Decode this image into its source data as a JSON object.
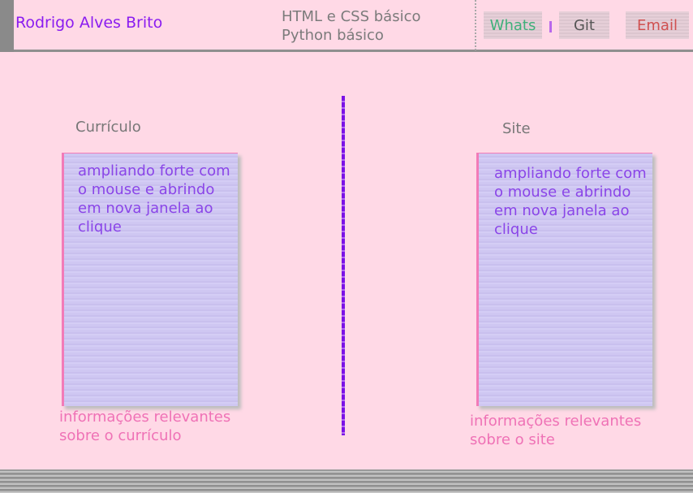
{
  "header": {
    "name": "Rodrigo Alves Brito",
    "skills": [
      "HTML e CSS básico",
      "Python básico"
    ],
    "contacts": {
      "whats": "Whats",
      "git": "Git",
      "email": "Email"
    }
  },
  "sections": [
    {
      "title": "Currículo",
      "card_text": "ampliando forte com o mouse e abrindo em nova janela ao clique",
      "description": "informações relevantes sobre o currículo"
    },
    {
      "title": "Site",
      "card_text": "ampliando forte com o mouse e abrindo em nova janela ao clique",
      "description": "informações relevantes sobre o site"
    }
  ],
  "colors": {
    "background": "#ffd9e6",
    "name": "#8a1cf0",
    "whats": "#3fb07a",
    "email": "#d05050",
    "card_text": "#8a45e8",
    "description": "#ef72b6",
    "divider": "#7b12e6"
  }
}
